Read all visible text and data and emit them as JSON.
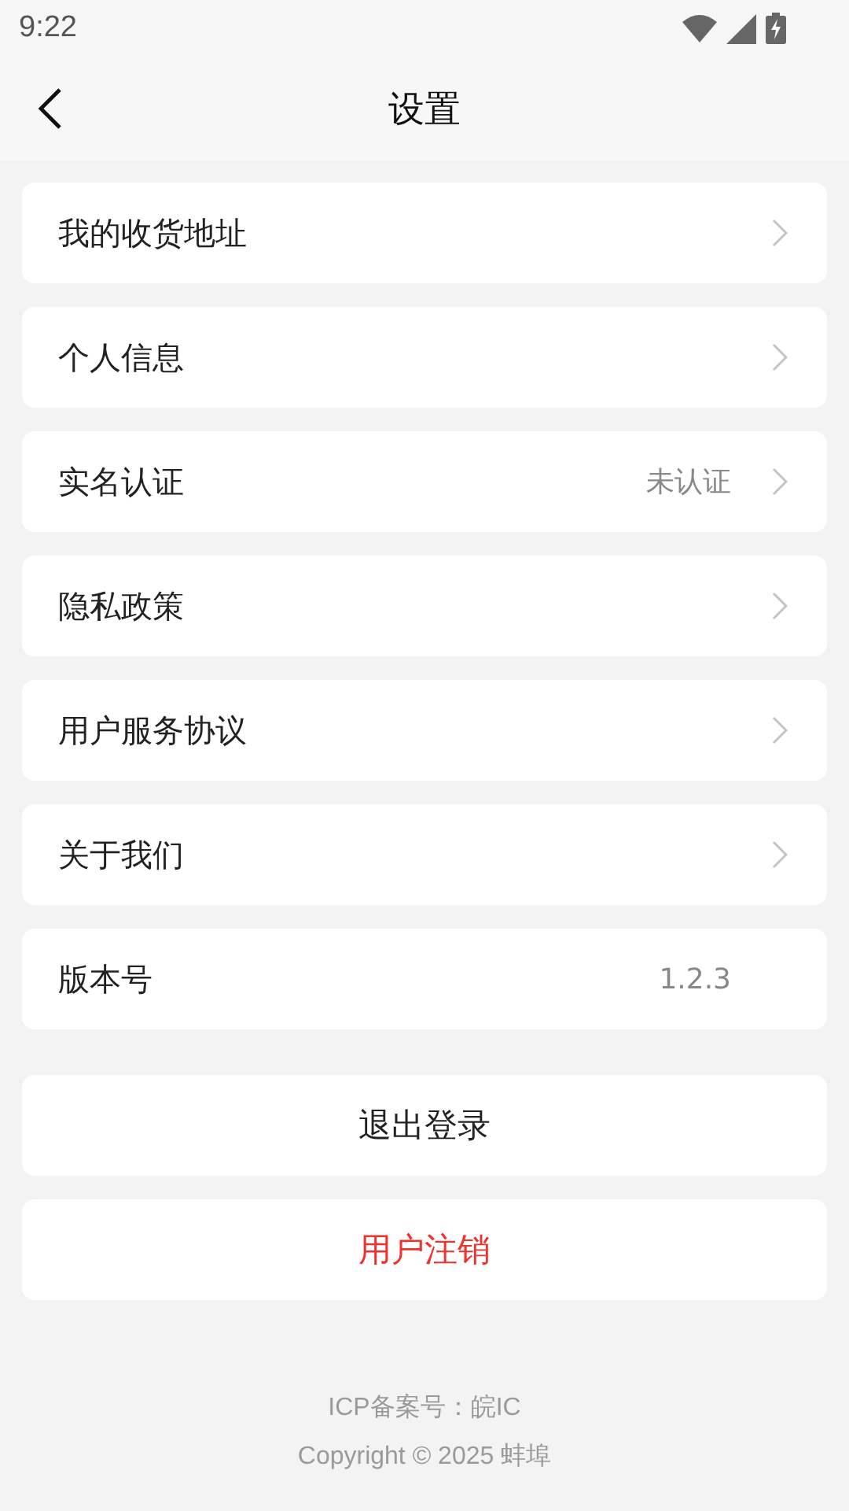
{
  "status_bar": {
    "time": "9:22"
  },
  "header": {
    "title": "设置"
  },
  "rows": [
    {
      "label": "我的收货地址",
      "chevron": true
    },
    {
      "label": "个人信息",
      "chevron": true
    },
    {
      "label": "实名认证",
      "value": "未认证",
      "chevron": true
    },
    {
      "label": "隐私政策",
      "chevron": true
    },
    {
      "label": "用户服务协议",
      "chevron": true
    },
    {
      "label": "关于我们",
      "chevron": true
    },
    {
      "label": "版本号",
      "value": "1.2.3",
      "chevron": false
    }
  ],
  "buttons": [
    {
      "label": "退出登录",
      "kind": "normal"
    },
    {
      "label": "用户注销",
      "kind": "danger"
    }
  ],
  "footer": [
    "ICP备案号：皖IC",
    "Copyright © 2025 蚌埠"
  ]
}
